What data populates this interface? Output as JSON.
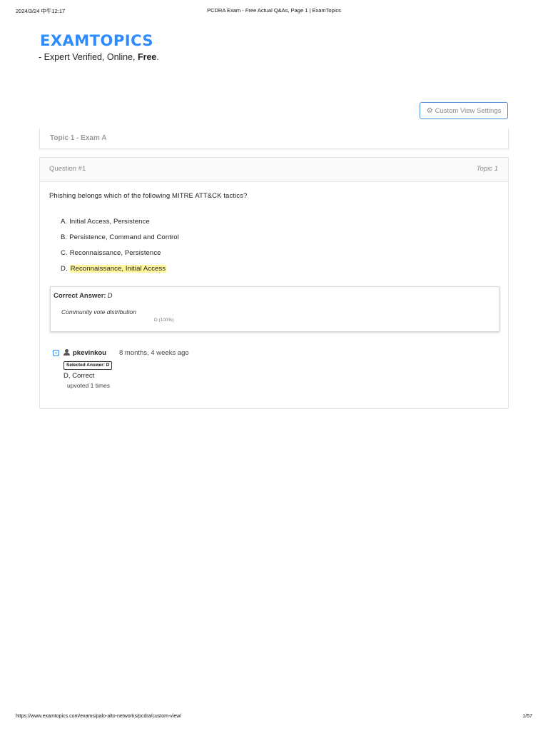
{
  "print_header": {
    "datetime": "2024/3/24 中午12:17",
    "title": "PCDRA Exam - Free Actual Q&As, Page 1 | ExamTopics"
  },
  "print_footer": {
    "url": "https://www.examtopics.com/exams/palo-alto-networks/pcdra/custom-view/",
    "page": "1/57"
  },
  "site": {
    "logo_text": "EXAMTOPICS",
    "tagline_prefix": "- Expert Verified, Online, ",
    "tagline_bold": "Free",
    "tagline_suffix": "."
  },
  "toolbar": {
    "custom_view_label": "Custom View Settings",
    "custom_view_icon": "gear-icon"
  },
  "topic": {
    "title": "Topic 1 - Exam A"
  },
  "question": {
    "number_label": "Question #1",
    "topic_label": "Topic 1",
    "text": "Phishing belongs which of the following MITRE ATT&CK tactics?",
    "choices": [
      {
        "letter": "A.",
        "text": "Initial Access, Persistence"
      },
      {
        "letter": "B.",
        "text": "Persistence, Command and Control"
      },
      {
        "letter": "C.",
        "text": "Reconnaissance, Persistence"
      },
      {
        "letter": "D.",
        "text": "Reconnaissance, Initial Access"
      }
    ],
    "correct_answer_label": "Correct Answer:",
    "correct_answer_value": "D",
    "community_label": "Community vote distribution",
    "vote_distribution": "D (100%)"
  },
  "comment": {
    "collapse_icon": "collapse-icon",
    "user_icon": "user-icon",
    "username": "pkevinkou",
    "time": "8 months, 4 weeks ago",
    "selected_answer": "Selected Answer: D",
    "text": "D, Correct",
    "upvotes": "upvoted 1 times"
  },
  "colors": {
    "brand": "#2d8bff",
    "highlight": "#fff59d"
  }
}
